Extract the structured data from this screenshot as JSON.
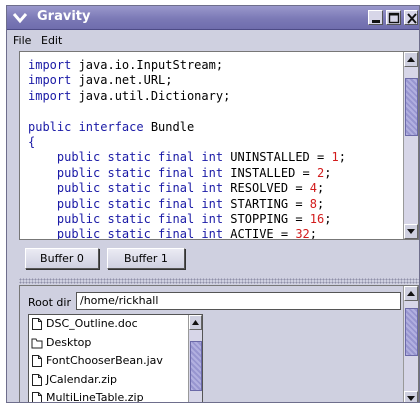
{
  "window": {
    "title": "Gravity",
    "title_bar_color": "#7b79b6"
  },
  "menu": {
    "items": [
      {
        "label": "File"
      },
      {
        "label": "Edit"
      }
    ]
  },
  "editor": {
    "lines": [
      [
        {
          "t": "import ",
          "c": "kw"
        },
        {
          "t": "java.io.InputStream;",
          "c": ""
        }
      ],
      [
        {
          "t": "import ",
          "c": "kw"
        },
        {
          "t": "java.net.URL;",
          "c": ""
        }
      ],
      [
        {
          "t": "import ",
          "c": "kw"
        },
        {
          "t": "java.util.Dictionary;",
          "c": ""
        }
      ],
      [],
      [
        {
          "t": "public interface ",
          "c": "kw"
        },
        {
          "t": "Bundle",
          "c": ""
        }
      ],
      [
        {
          "t": "{",
          "c": "kw"
        }
      ],
      [
        {
          "t": "    public static final int ",
          "c": "kw"
        },
        {
          "t": "UNINSTALLED = ",
          "c": ""
        },
        {
          "t": "1",
          "c": "num"
        },
        {
          "t": ";",
          "c": ""
        }
      ],
      [
        {
          "t": "    public static final int ",
          "c": "kw"
        },
        {
          "t": "INSTALLED = ",
          "c": ""
        },
        {
          "t": "2",
          "c": "num"
        },
        {
          "t": ";",
          "c": ""
        }
      ],
      [
        {
          "t": "    public static final int ",
          "c": "kw"
        },
        {
          "t": "RESOLVED = ",
          "c": ""
        },
        {
          "t": "4",
          "c": "num"
        },
        {
          "t": ";",
          "c": ""
        }
      ],
      [
        {
          "t": "    public static final int ",
          "c": "kw"
        },
        {
          "t": "STARTING = ",
          "c": ""
        },
        {
          "t": "8",
          "c": "num"
        },
        {
          "t": ";",
          "c": ""
        }
      ],
      [
        {
          "t": "    public static final int ",
          "c": "kw"
        },
        {
          "t": "STOPPING = ",
          "c": ""
        },
        {
          "t": "16",
          "c": "num"
        },
        {
          "t": ";",
          "c": ""
        }
      ],
      [
        {
          "t": "    public static final int ",
          "c": "kw"
        },
        {
          "t": "ACTIVE = ",
          "c": ""
        },
        {
          "t": "32",
          "c": "num"
        },
        {
          "t": ";",
          "c": ""
        }
      ]
    ]
  },
  "buffers": {
    "buffer0_label": "Buffer 0",
    "buffer1_label": "Buffer 1"
  },
  "browser": {
    "root_label": "Root dir",
    "root_value": "/home/rickhall",
    "files": [
      {
        "name": "DSC_Outline.doc",
        "icon": "file-icon"
      },
      {
        "name": "Desktop",
        "icon": "folder-icon"
      },
      {
        "name": "FontChooserBean.jav",
        "icon": "file-icon"
      },
      {
        "name": "JCalendar.zip",
        "icon": "file-icon"
      },
      {
        "name": "MultiLineTable.zip",
        "icon": "file-icon"
      }
    ]
  },
  "colors": {
    "keyword": "#1a1aa6",
    "number": "#d21b1b",
    "background": "#cfd0e0"
  }
}
